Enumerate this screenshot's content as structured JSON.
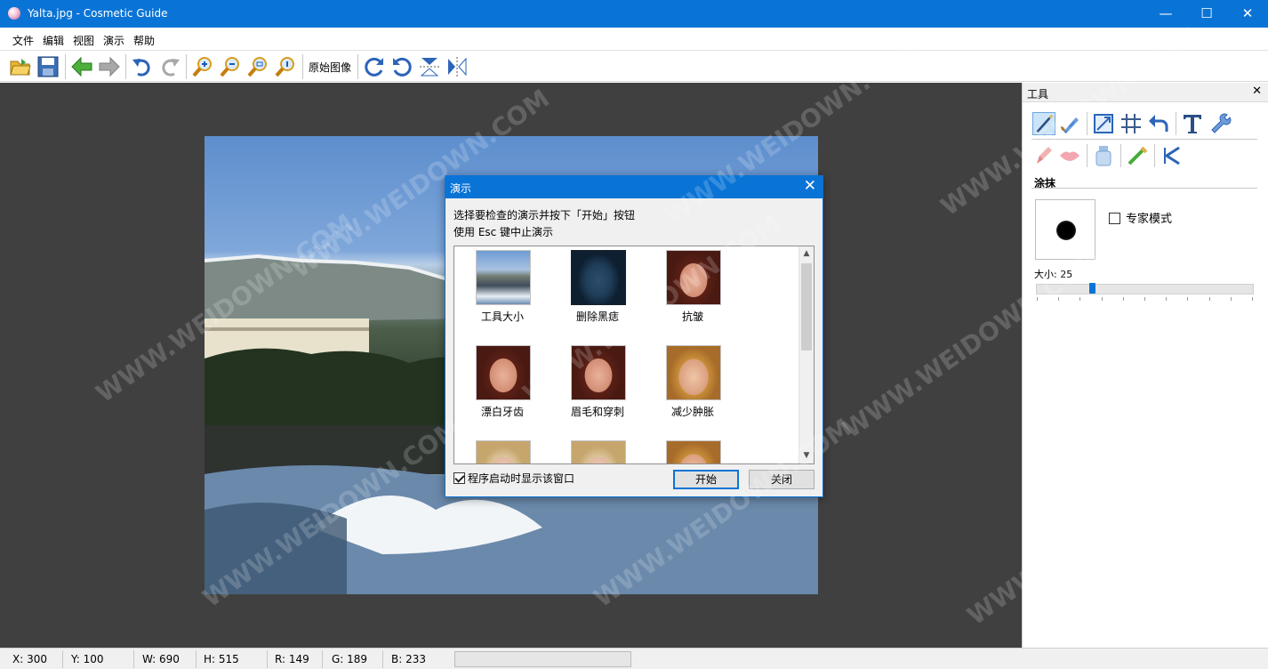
{
  "window": {
    "title": "Yalta.jpg - Cosmetic Guide",
    "minimize_glyph": "—",
    "maximize_glyph": "☐",
    "close_glyph": "✕"
  },
  "menu": [
    "文件",
    "编辑",
    "视图",
    "演示",
    "帮助"
  ],
  "toolbar": {
    "original_image_label": "原始图像",
    "icons": [
      "open-folder-icon",
      "save-icon",
      "back-arrow-icon",
      "forward-arrow-icon",
      "undo-icon",
      "redo-icon",
      "zoom-in-icon",
      "zoom-out-icon",
      "zoom-fit-icon",
      "zoom-actual-icon",
      "rotate-cw-icon",
      "rotate-ccw-icon",
      "flip-vertical-icon",
      "flip-horizontal-icon"
    ]
  },
  "panel": {
    "title": "工具",
    "close_glyph": "✕",
    "section_title": "涂抹",
    "expert_mode_label": "专家模式",
    "expert_mode_checked": false,
    "size_label": "大小: 25",
    "size_value": 25,
    "size_max": 100
  },
  "dialog": {
    "title": "演示",
    "close_glyph": "✕",
    "line1": "选择要检查的演示并按下「开始」按钮",
    "line2": "使用 Esc 键中止演示",
    "items": [
      {
        "label": "工具大小"
      },
      {
        "label": "删除黑痣"
      },
      {
        "label": "抗皱"
      },
      {
        "label": "漂白牙齿"
      },
      {
        "label": "眉毛和穿刺"
      },
      {
        "label": "减少肿胀"
      }
    ],
    "show_on_start_label": "程序启动时显示该窗口",
    "show_on_start_checked": true,
    "start_button": "开始",
    "close_button": "关闭",
    "scroll_up_glyph": "▲",
    "scroll_down_glyph": "▼"
  },
  "status": {
    "x": "X: 300",
    "y": "Y: 100",
    "w": "W: 690",
    "h": "H: 515",
    "r": "R: 149",
    "g": "G: 189",
    "b": "B: 233"
  },
  "watermark": "WWW.WEIDOWN.COM",
  "colors": {
    "accent": "#0a74d6",
    "workspace": "#404040"
  }
}
